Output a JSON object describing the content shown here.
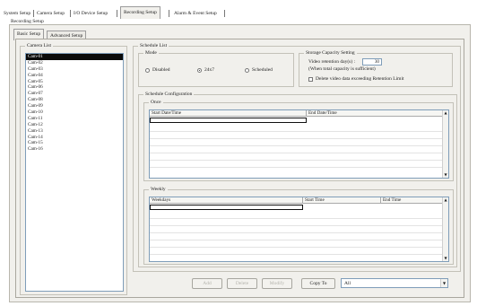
{
  "top_tabs": [
    {
      "label": "System Setup",
      "active": false
    },
    {
      "label": "Camera Setup",
      "active": false
    },
    {
      "label": "I/O Device Setup",
      "active": false
    },
    {
      "label": "Recording Setup",
      "active": true
    },
    {
      "label": "Alarm & Event Setup",
      "active": false
    }
  ],
  "section_title": "Recording Setup",
  "sub_tabs": [
    {
      "label": "Basic Setup",
      "active": true
    },
    {
      "label": "Advanced Setup",
      "active": false
    }
  ],
  "camera_list": {
    "label": "Camera List",
    "items": [
      "Cam-01",
      "Cam-02",
      "Cam-03",
      "Cam-04",
      "Cam-05",
      "Cam-06",
      "Cam-07",
      "Cam-08",
      "Cam-09",
      "Cam-10",
      "Cam-11",
      "Cam-12",
      "Cam-13",
      "Cam-14",
      "Cam-15",
      "Cam-16"
    ],
    "selected": "Cam-01"
  },
  "schedule_list": {
    "label": "Schedule List",
    "mode": {
      "label": "Mode",
      "options": [
        "Disabled",
        "24x7",
        "Scheduled"
      ],
      "selected": "24x7"
    }
  },
  "storage": {
    "label": "Storage Capacity Setting",
    "retention_label": "Video retention day(s) :",
    "retention_value": "30",
    "retention_note": "(When total capacity is sufficient)",
    "delete_label": "Delete video data exceeding Retention Limit",
    "delete_checked": false
  },
  "schedule_config": {
    "label": "Schedule Configuration",
    "once": {
      "label": "Once",
      "columns": [
        "Start Date/Time",
        "End Date/Time"
      ]
    },
    "weekly": {
      "label": "Weekly",
      "columns": [
        "Weekdays",
        "Start Time",
        "End Time"
      ]
    }
  },
  "buttons": {
    "add": "Add",
    "delete": "Delete",
    "modify": "Modify",
    "copy_to": "Copy To"
  },
  "copy_to_select": {
    "value": "All"
  },
  "icons": {
    "dropdown": "chevron-down-icon",
    "scroll_up": "chevron-up-icon",
    "scroll_down": "chevron-down-icon"
  },
  "colors": {
    "selection": "#0a0a0a",
    "panel": "#f1f0ec",
    "border": "#7f9db9"
  }
}
